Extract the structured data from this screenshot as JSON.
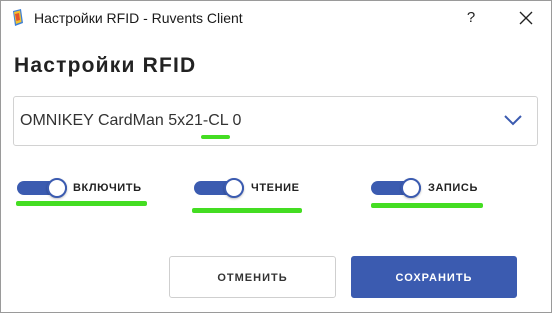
{
  "window": {
    "title": "Настройки RFID - Ruvents Client",
    "help_label": "?",
    "icon": "ruvents-app-icon",
    "close_icon": "close-icon"
  },
  "page": {
    "title": "Настройки RFID"
  },
  "device_select": {
    "value": "OMNIKEY CardMan 5x21-CL 0",
    "icon": "chevron-down-icon"
  },
  "toggles": [
    {
      "label": "ВКЛЮЧИТЬ",
      "on": true
    },
    {
      "label": "ЧТЕНИЕ",
      "on": true
    },
    {
      "label": "ЗАПИСЬ",
      "on": true
    }
  ],
  "buttons": {
    "cancel_label": "ОТМЕНИТЬ",
    "save_label": "СОХРАНИТЬ"
  },
  "colors": {
    "accent": "#3b5bb0",
    "highlight": "#44dd22"
  }
}
